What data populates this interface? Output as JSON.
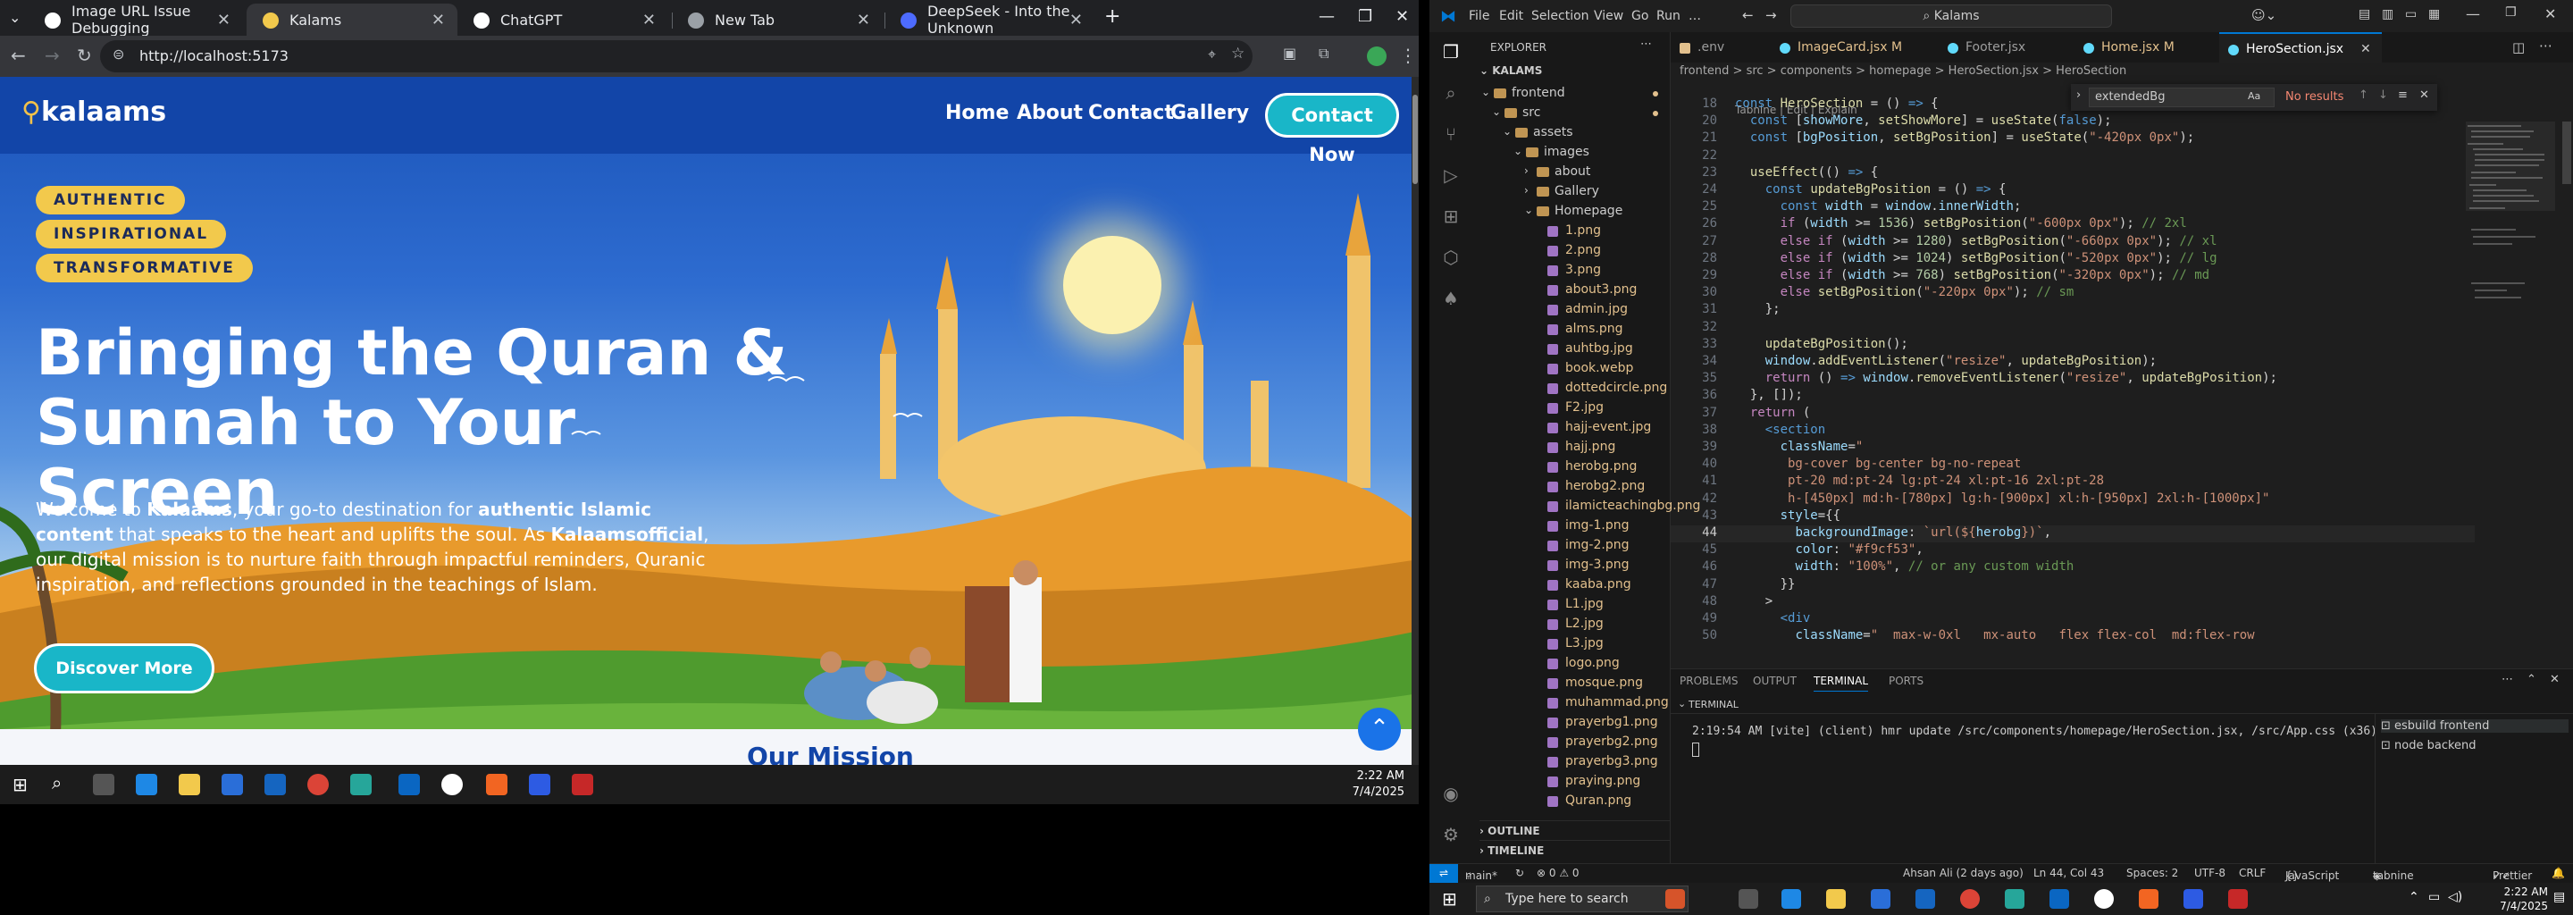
{
  "browser": {
    "tabs": [
      {
        "label": "Image URL Issue Debugging"
      },
      {
        "label": "Kalams"
      },
      {
        "label": "ChatGPT"
      },
      {
        "label": "New Tab"
      },
      {
        "label": "DeepSeek - Into the Unknown"
      }
    ],
    "url": "http://localhost:5173"
  },
  "site": {
    "logo": "kalaams",
    "nav": [
      "Home",
      "About",
      "Contact",
      "Gallery"
    ],
    "contact_btn": "Contact Now",
    "badges": [
      "AUTHENTIC",
      "INSPIRATIONAL",
      "TRANSFORMATIVE"
    ],
    "title": "Bringing the Quran & Sunnah to Your Screen",
    "intro_1": "Welcome to ",
    "intro_b1": "Kalaams",
    "intro_2": ", your go-to destination for ",
    "intro_b2": "authentic Islamic content",
    "intro_3": " that speaks to the heart and uplifts the soul. As ",
    "intro_b3": "Kalaamsofficial",
    "intro_4": ", our digital mission is to nurture faith through impactful reminders, Quranic inspiration, and reflections grounded in the teachings of Islam.",
    "discover_btn": "Discover More",
    "mission_peek": "Our Mission"
  },
  "left_taskbar": {
    "time": "2:22 AM",
    "date": "7/4/2025"
  },
  "vscode": {
    "menus": [
      "File",
      "Edit",
      "Selection",
      "View",
      "Go",
      "Run",
      "…"
    ],
    "search": "Kalams",
    "explorer_title": "EXPLORER",
    "workspace": "KALAMS",
    "tree": [
      {
        "label": "frontend",
        "kind": "folder",
        "depth": 1,
        "open": true
      },
      {
        "label": "src",
        "kind": "folder",
        "depth": 2,
        "open": true
      },
      {
        "label": "assets",
        "kind": "folder",
        "depth": 3,
        "open": true
      },
      {
        "label": "images",
        "kind": "folder",
        "depth": 4,
        "open": true
      },
      {
        "label": "about",
        "kind": "folder",
        "depth": 5,
        "open": false
      },
      {
        "label": "Gallery",
        "kind": "folder",
        "depth": 5,
        "open": false
      },
      {
        "label": "Homepage",
        "kind": "folder",
        "depth": 5,
        "open": true
      },
      {
        "label": "1.png",
        "kind": "file",
        "depth": 6
      },
      {
        "label": "2.png",
        "kind": "file",
        "depth": 6
      },
      {
        "label": "3.png",
        "kind": "file",
        "depth": 6
      },
      {
        "label": "about3.png",
        "kind": "file",
        "depth": 6
      },
      {
        "label": "admin.jpg",
        "kind": "file",
        "depth": 6
      },
      {
        "label": "alms.png",
        "kind": "file",
        "depth": 6
      },
      {
        "label": "auhtbg.jpg",
        "kind": "file",
        "depth": 6
      },
      {
        "label": "book.webp",
        "kind": "file",
        "depth": 6
      },
      {
        "label": "dottedcircle.png",
        "kind": "file",
        "depth": 6
      },
      {
        "label": "F2.jpg",
        "kind": "file",
        "depth": 6
      },
      {
        "label": "hajj-event.jpg",
        "kind": "file",
        "depth": 6
      },
      {
        "label": "hajj.png",
        "kind": "file",
        "depth": 6
      },
      {
        "label": "herobg.png",
        "kind": "file",
        "depth": 6
      },
      {
        "label": "herobg2.png",
        "kind": "file",
        "depth": 6
      },
      {
        "label": "ilamicteachingbg.png",
        "kind": "file",
        "depth": 6
      },
      {
        "label": "img-1.png",
        "kind": "file",
        "depth": 6
      },
      {
        "label": "img-2.png",
        "kind": "file",
        "depth": 6
      },
      {
        "label": "img-3.png",
        "kind": "file",
        "depth": 6
      },
      {
        "label": "kaaba.png",
        "kind": "file",
        "depth": 6
      },
      {
        "label": "L1.jpg",
        "kind": "file",
        "depth": 6
      },
      {
        "label": "L2.jpg",
        "kind": "file",
        "depth": 6
      },
      {
        "label": "L3.jpg",
        "kind": "file",
        "depth": 6
      },
      {
        "label": "logo.png",
        "kind": "file",
        "depth": 6
      },
      {
        "label": "mosque.png",
        "kind": "file",
        "depth": 6
      },
      {
        "label": "muhammad.png",
        "kind": "file",
        "depth": 6
      },
      {
        "label": "prayerbg1.png",
        "kind": "file",
        "depth": 6
      },
      {
        "label": "prayerbg2.png",
        "kind": "file",
        "depth": 6
      },
      {
        "label": "prayerbg3.png",
        "kind": "file",
        "depth": 6
      },
      {
        "label": "praying.png",
        "kind": "file",
        "depth": 6
      },
      {
        "label": "Quran.png",
        "kind": "file",
        "depth": 6
      }
    ],
    "outline": "OUTLINE",
    "timeline": "TIMELINE",
    "editor_tabs": [
      ".env",
      "ImageCard.jsx M",
      "Footer.jsx",
      "Home.jsx M",
      "HeroSection.jsx"
    ],
    "breadcrumb": "frontend > src > components > homepage > HeroSection.jsx > HeroSection",
    "codelens": "Tabnine | Edit | Explain",
    "find_value": "extendedBg",
    "find_result": "No results",
    "code_lines": [
      {
        "n": "18",
        "html": "<span class='k'>const</span> <span class='f'>HeroSection</span> = () <span class='k'>=></span> {"
      },
      {
        "n": "20",
        "html": "  <span class='k'>const</span> [<span class='v'>showMore</span>, <span class='f'>setShowMore</span>] = <span class='f'>useState</span>(<span class='k'>false</span>);"
      },
      {
        "n": "21",
        "html": "  <span class='k'>const</span> [<span class='v'>bgPosition</span>, <span class='f'>setBgPosition</span>] = <span class='f'>useState</span>(<span class='s'>\"-420px 0px\"</span>);"
      },
      {
        "n": "22",
        "html": ""
      },
      {
        "n": "23",
        "html": "  <span class='f'>useEffect</span>(() <span class='k'>=></span> {"
      },
      {
        "n": "24",
        "html": "    <span class='k'>const</span> <span class='f'>updateBgPosition</span> = () <span class='k'>=></span> {"
      },
      {
        "n": "25",
        "html": "      <span class='k'>const</span> <span class='v'>width</span> = <span class='v'>window</span>.<span class='v'>innerWidth</span>;"
      },
      {
        "n": "26",
        "html": "      <span class='p'>if</span> (<span class='v'>width</span> >= <span class='n'>1536</span>) <span class='f'>setBgPosition</span>(<span class='s'>\"-600px 0px\"</span>); <span class='c'>// 2xl</span>"
      },
      {
        "n": "27",
        "html": "      <span class='p'>else if</span> (<span class='v'>width</span> >= <span class='n'>1280</span>) <span class='f'>setBgPosition</span>(<span class='s'>\"-660px 0px\"</span>); <span class='c'>// xl</span>"
      },
      {
        "n": "28",
        "html": "      <span class='p'>else if</span> (<span class='v'>width</span> >= <span class='n'>1024</span>) <span class='f'>setBgPosition</span>(<span class='s'>\"-520px 0px\"</span>); <span class='c'>// lg</span>"
      },
      {
        "n": "29",
        "html": "      <span class='p'>else if</span> (<span class='v'>width</span> >= <span class='n'>768</span>) <span class='f'>setBgPosition</span>(<span class='s'>\"-320px 0px\"</span>); <span class='c'>// md</span>"
      },
      {
        "n": "30",
        "html": "      <span class='p'>else</span> <span class='f'>setBgPosition</span>(<span class='s'>\"-220px 0px\"</span>); <span class='c'>// sm</span>"
      },
      {
        "n": "31",
        "html": "    };"
      },
      {
        "n": "32",
        "html": ""
      },
      {
        "n": "33",
        "html": "    <span class='f'>updateBgPosition</span>();"
      },
      {
        "n": "34",
        "html": "    <span class='v'>window</span>.<span class='f'>addEventListener</span>(<span class='s'>\"resize\"</span>, <span class='f'>updateBgPosition</span>);"
      },
      {
        "n": "35",
        "html": "    <span class='p'>return</span> () <span class='k'>=></span> <span class='v'>window</span>.<span class='f'>removeEventListener</span>(<span class='s'>\"resize\"</span>, <span class='f'>updateBgPosition</span>);"
      },
      {
        "n": "36",
        "html": "  }, []);"
      },
      {
        "n": "37",
        "html": "  <span class='p'>return</span> ("
      },
      {
        "n": "38",
        "html": "    <span class='k'>&lt;</span><span class='k'>section</span>"
      },
      {
        "n": "39",
        "html": "      <span class='v'>className</span>=<span class='s'>\"</span>"
      },
      {
        "n": "40",
        "html": "<span class='s'>       bg-cover bg-center bg-no-repeat</span>"
      },
      {
        "n": "41",
        "html": "<span class='s'>       pt-20 md:pt-24 lg:pt-24 xl:pt-16 2xl:pt-28</span>"
      },
      {
        "n": "42",
        "html": "<span class='s'>       h-[450px] md:h-[780px] lg:h-[900px] xl:h-[950px] 2xl:h-[1000px]\"</span>"
      },
      {
        "n": "43",
        "html": "      <span class='v'>style</span>={{"
      },
      {
        "n": "44",
        "html": "        <span class='v'>backgroundImage</span>: <span class='s'>`url(${</span><span class='v'>herobg</span><span class='s'>})`</span>,"
      },
      {
        "n": "45",
        "html": "        <span class='v'>color</span>: <span class='s'>\"#f9cf53\"</span>,"
      },
      {
        "n": "46",
        "html": "        <span class='v'>width</span>: <span class='s'>\"100%\"</span>, <span class='c'>// or any custom width</span>"
      },
      {
        "n": "47",
        "html": "      }}"
      },
      {
        "n": "48",
        "html": "    >"
      },
      {
        "n": "49",
        "html": "      <span class='k'>&lt;div</span>"
      },
      {
        "n": "50",
        "html": "        <span class='v'>className</span>=<span class='s'>\"  max-w-0xl   mx-auto   flex flex-col  md:flex-row</span>"
      }
    ],
    "panel_tabs": [
      "PROBLEMS",
      "OUTPUT",
      "TERMINAL",
      "PORTS"
    ],
    "terminal_title": "TERMINAL",
    "terminal_line": "2:19:54 AM [vite] (client) hmr update /src/components/homepage/HeroSection.jsx, /src/App.css (x36)",
    "terminal_sessions": [
      "esbuild frontend",
      "node backend"
    ],
    "status": {
      "branch": "main*",
      "errors": "⊗ 0 ⚠ 0",
      "blame": "Ahsan Ali (2 days ago)",
      "position": "Ln 44, Col 43",
      "spaces": "Spaces: 2",
      "encoding": "UTF-8",
      "eol": "CRLF",
      "lang": "JavaScript JSX",
      "tabnine": "tabnine basic",
      "prettier": "Prettier"
    }
  },
  "right_taskbar": {
    "search": "Type here to search",
    "time": "2:22 AM",
    "date": "7/4/2025"
  },
  "colors": {
    "site_nav": "#1245a8",
    "accent_teal": "#19b6c8",
    "badge_yellow": "#f2c94c",
    "vscode_accent": "#0078d4"
  }
}
